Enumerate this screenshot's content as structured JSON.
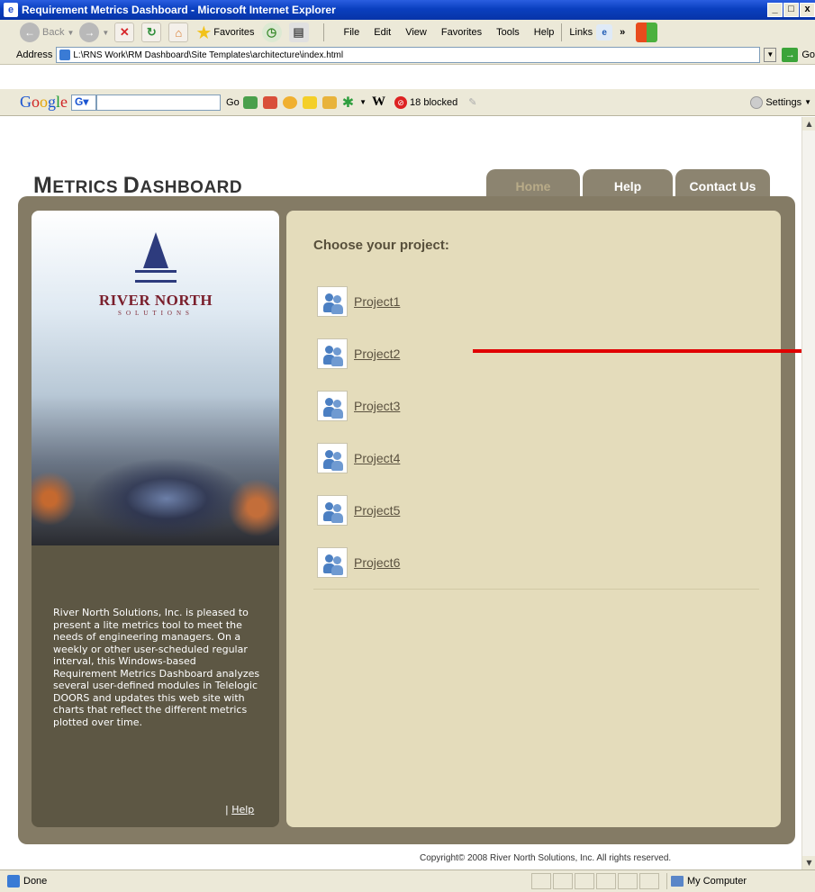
{
  "window": {
    "title": "Requirement Metrics Dashboard - Microsoft Internet Explorer"
  },
  "toolbar": {
    "back_label": "Back",
    "favorites_label": "Favorites",
    "menu": [
      "File",
      "Edit",
      "View",
      "Favorites",
      "Tools",
      "Help"
    ],
    "links_label": "Links"
  },
  "address": {
    "label": "Address",
    "value": "L:\\RNS Work\\RM Dashboard\\Site Templates\\architecture\\index.html",
    "go_label": "Go"
  },
  "google_bar": {
    "go_label": "Go",
    "blocked_label": "18 blocked",
    "settings_label": "Settings"
  },
  "dashboard": {
    "title_first_letter": "M",
    "title_rest_1": "ETRICS ",
    "title_second_letter": "D",
    "title_rest_2": "ASHBOARD",
    "tabs": [
      "Home",
      "Help",
      "Contact Us"
    ],
    "logo_brand": "RIVER NORTH",
    "logo_tag": "SOLUTIONS",
    "blurb": "River North Solutions, Inc. is pleased to present a lite metrics tool to meet the needs of engineering managers. On a weekly or other user-scheduled regular interval, this Windows-based Requirement Metrics Dashboard analyzes several user-defined modules in Telelogic DOORS and updates this web site with charts that reflect the different metrics plotted over time.",
    "help_link": "Help",
    "choose_heading": "Choose your project:",
    "projects": [
      "Project1",
      "Project2",
      "Project3",
      "Project4",
      "Project5",
      "Project6"
    ],
    "copyright": "Copyright© 2008 River North Solutions, Inc. All rights reserved."
  },
  "status": {
    "left": "Done",
    "zone": "My Computer"
  },
  "colors": {
    "frame": "#847b65",
    "main_panel": "#e4dcbb",
    "left_panel": "#5d5744",
    "annotation_red": "#e00000"
  }
}
